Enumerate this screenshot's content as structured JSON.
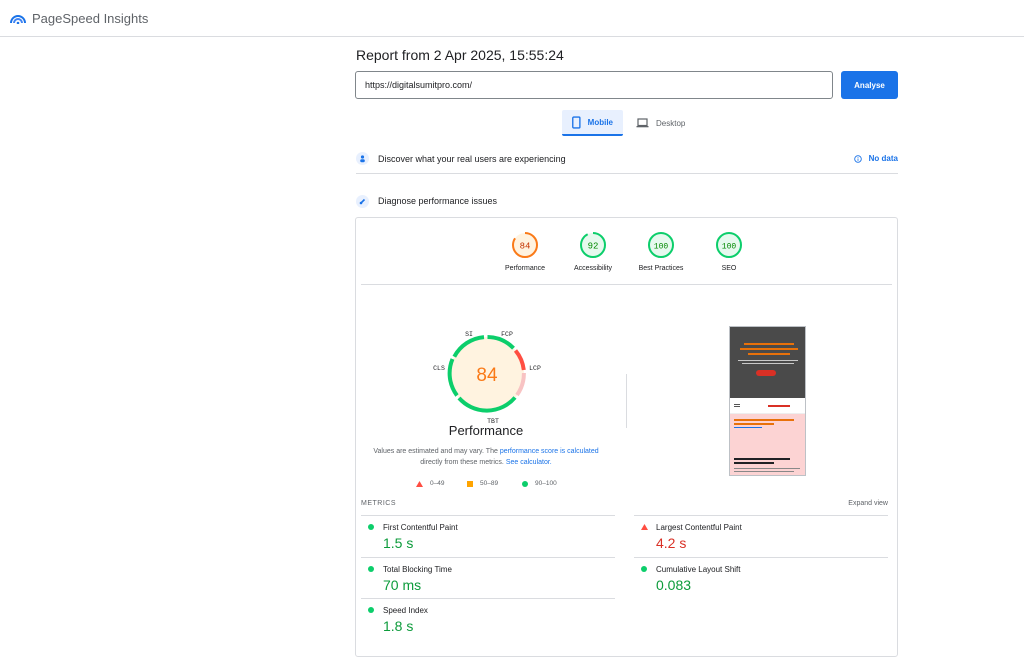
{
  "app": {
    "title": "PageSpeed Insights"
  },
  "report": {
    "title": "Report from 2 Apr 2025, 15:55:24"
  },
  "search": {
    "url": "https://digitalsumitpro.com/",
    "analyse_label": "Analyse"
  },
  "tabs": [
    {
      "label": "Mobile",
      "active": true
    },
    {
      "label": "Desktop",
      "active": false
    }
  ],
  "sections": {
    "discover": {
      "label": "Discover what your real users are experiencing",
      "status": "No data"
    },
    "diagnose": {
      "label": "Diagnose performance issues"
    }
  },
  "scores": [
    {
      "label": "Performance",
      "value": "84",
      "color": "#fa7a18"
    },
    {
      "label": "Accessibility",
      "value": "92",
      "color": "#0cce6b"
    },
    {
      "label": "Best Practices",
      "value": "100",
      "color": "#0cce6b"
    },
    {
      "label": "SEO",
      "value": "100",
      "color": "#0cce6b"
    }
  ],
  "performance_gauge": {
    "score": "84",
    "label": "Performance",
    "segments": {
      "si": "SI",
      "fcp": "FCP",
      "lcp": "LCP",
      "tbt": "TBT",
      "cls": "CLS"
    }
  },
  "note": {
    "part1": "Values are estimated and may vary. The ",
    "link1": "performance score is calculated",
    "part2": " directly from these metrics. ",
    "link2": "See calculator."
  },
  "legend": [
    {
      "range": "0–49",
      "color": "#ff4e42"
    },
    {
      "range": "50–89",
      "color": "#ffa400"
    },
    {
      "range": "90–100",
      "color": "#0cce6b"
    }
  ],
  "metrics": {
    "heading": "METRICS",
    "expand_label": "Expand view",
    "items": [
      {
        "name": "First Contentful Paint",
        "value": "1.5 s",
        "status": "good"
      },
      {
        "name": "Largest Contentful Paint",
        "value": "4.2 s",
        "status": "poor"
      },
      {
        "name": "Total Blocking Time",
        "value": "70 ms",
        "status": "good"
      },
      {
        "name": "Cumulative Layout Shift",
        "value": "0.083",
        "status": "good"
      },
      {
        "name": "Speed Index",
        "value": "1.8 s",
        "status": "good"
      }
    ]
  }
}
